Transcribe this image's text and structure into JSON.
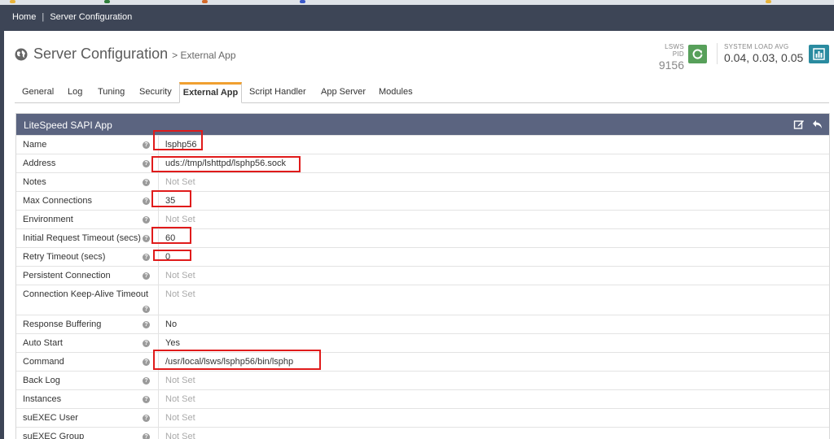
{
  "breadcrumb": {
    "home": "Home",
    "separator": "|",
    "current": "Server Configuration"
  },
  "page": {
    "title": "Server Configuration",
    "subtitle": "> External App",
    "icon": "globe-icon"
  },
  "status": {
    "pid_label": "LSWS PID",
    "pid_value": "9156",
    "load_label": "SYSTEM LOAD AVG",
    "load_value": "0.04, 0.03, 0.05",
    "reload_icon": "reload-icon",
    "chart_icon": "bar-chart-icon",
    "reload_color": "#57a05a",
    "chart_color": "#2a8ba0"
  },
  "tabs": [
    {
      "label": "General",
      "active": false
    },
    {
      "label": "Log",
      "active": false
    },
    {
      "label": "Tuning",
      "active": false
    },
    {
      "label": "Security",
      "active": false
    },
    {
      "label": "External App",
      "active": true
    },
    {
      "label": "Script Handler",
      "active": false
    },
    {
      "label": "App Server",
      "active": false
    },
    {
      "label": "Modules",
      "active": false
    }
  ],
  "panel": {
    "title": "LiteSpeed SAPI App",
    "edit_icon": "edit-icon",
    "back_icon": "back-arrow-icon",
    "header_color": "#5b6480",
    "help_glyph": "?",
    "rows": [
      {
        "label": "Name",
        "value": "lsphp56",
        "notset": false,
        "highlight": true
      },
      {
        "label": "Address",
        "value": "uds://tmp/lshttpd/lsphp56.sock",
        "notset": false,
        "highlight": true
      },
      {
        "label": "Notes",
        "value": "Not Set",
        "notset": true,
        "highlight": false
      },
      {
        "label": "Max Connections",
        "value": "35",
        "notset": false,
        "highlight": true
      },
      {
        "label": "Environment",
        "value": "Not Set",
        "notset": true,
        "highlight": false
      },
      {
        "label": "Initial Request Timeout (secs)",
        "value": "60",
        "notset": false,
        "highlight": true
      },
      {
        "label": "Retry Timeout (secs)",
        "value": "0",
        "notset": false,
        "highlight": true
      },
      {
        "label": "Persistent Connection",
        "value": "Not Set",
        "notset": true,
        "highlight": false
      },
      {
        "label": "Connection Keep-Alive Timeout",
        "value": "Not Set",
        "notset": true,
        "highlight": false
      },
      {
        "label": "Response Buffering",
        "value": "No",
        "notset": false,
        "highlight": false
      },
      {
        "label": "Auto Start",
        "value": "Yes",
        "notset": false,
        "highlight": false
      },
      {
        "label": "Command",
        "value": "/usr/local/lsws/lsphp56/bin/lsphp",
        "notset": false,
        "highlight": true
      },
      {
        "label": "Back Log",
        "value": "Not Set",
        "notset": true,
        "highlight": false
      },
      {
        "label": "Instances",
        "value": "Not Set",
        "notset": true,
        "highlight": false
      },
      {
        "label": "suEXEC User",
        "value": "Not Set",
        "notset": true,
        "highlight": false
      },
      {
        "label": "suEXEC Group",
        "value": "Not Set",
        "notset": true,
        "highlight": false
      }
    ]
  },
  "highlight_color": "#e01b1b"
}
